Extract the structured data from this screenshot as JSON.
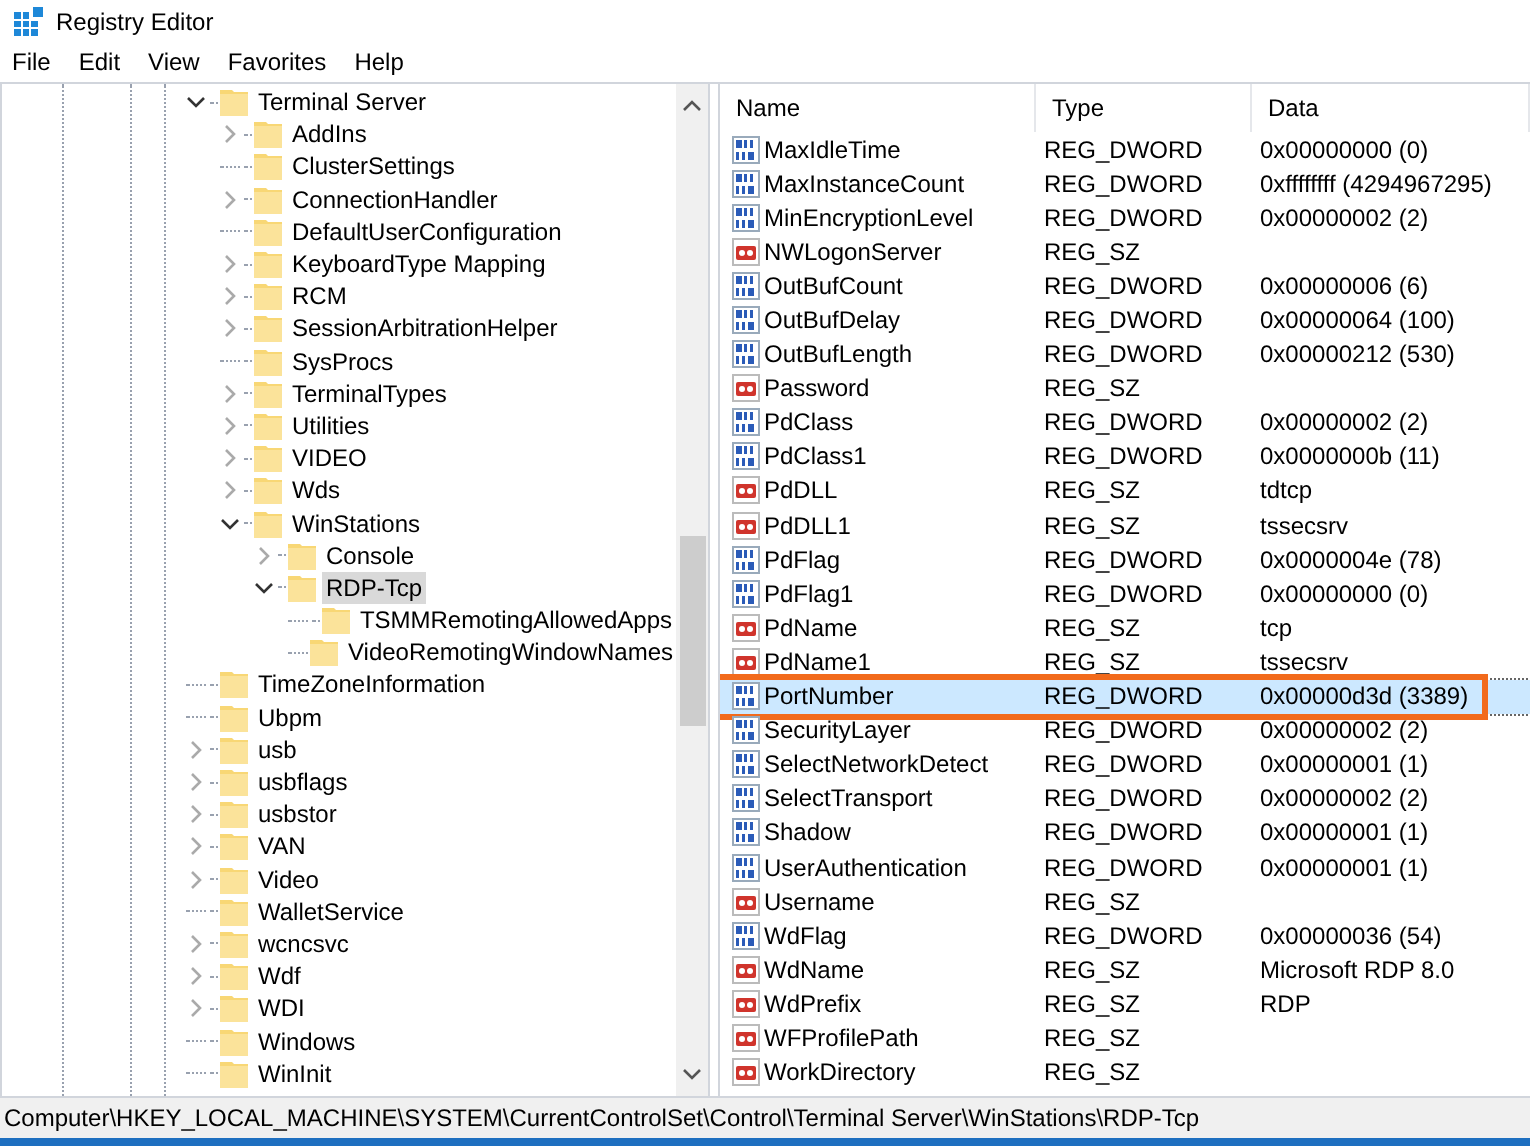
{
  "window": {
    "title": "Registry Editor"
  },
  "menu": [
    "File",
    "Edit",
    "View",
    "Favorites",
    "Help"
  ],
  "tree": [
    {
      "label": "Terminal Server",
      "expanded": true,
      "selected": false,
      "children": [
        {
          "label": "AddIns",
          "expanded": false,
          "selected": false
        },
        {
          "label": "ClusterSettings",
          "selected": false
        },
        {
          "label": "ConnectionHandler",
          "expanded": false,
          "selected": false
        },
        {
          "label": "DefaultUserConfiguration",
          "selected": false
        },
        {
          "label": "KeyboardType Mapping",
          "expanded": false,
          "selected": false
        },
        {
          "label": "RCM",
          "expanded": false,
          "selected": false
        },
        {
          "label": "SessionArbitrationHelper",
          "expanded": false,
          "selected": false
        },
        {
          "label": "SysProcs",
          "selected": false
        },
        {
          "label": "TerminalTypes",
          "expanded": false,
          "selected": false
        },
        {
          "label": "Utilities",
          "expanded": false,
          "selected": false
        },
        {
          "label": "VIDEO",
          "expanded": false,
          "selected": false
        },
        {
          "label": "Wds",
          "expanded": false,
          "selected": false
        },
        {
          "label": "WinStations",
          "expanded": true,
          "selected": false,
          "children": [
            {
              "label": "Console",
              "expanded": false,
              "selected": false
            },
            {
              "label": "RDP-Tcp",
              "expanded": true,
              "selected": true,
              "children": [
                {
                  "label": "TSMMRemotingAllowedApps",
                  "selected": false
                },
                {
                  "label": "VideoRemotingWindowNames",
                  "selected": false
                }
              ]
            }
          ]
        }
      ]
    },
    {
      "label": "TimeZoneInformation",
      "selected": false
    },
    {
      "label": "Ubpm",
      "selected": false
    },
    {
      "label": "usb",
      "expanded": false,
      "selected": false
    },
    {
      "label": "usbflags",
      "expanded": false,
      "selected": false
    },
    {
      "label": "usbstor",
      "expanded": false,
      "selected": false
    },
    {
      "label": "VAN",
      "expanded": false,
      "selected": false
    },
    {
      "label": "Video",
      "expanded": false,
      "selected": false
    },
    {
      "label": "WalletService",
      "selected": false
    },
    {
      "label": "wcncsvc",
      "expanded": false,
      "selected": false
    },
    {
      "label": "Wdf",
      "expanded": false,
      "selected": false
    },
    {
      "label": "WDI",
      "expanded": false,
      "selected": false
    },
    {
      "label": "Windows",
      "selected": false
    },
    {
      "label": "WinInit",
      "selected": false
    }
  ],
  "table": {
    "columns": [
      "Name",
      "Type",
      "Data"
    ],
    "rows": [
      {
        "kind": "dword",
        "name": "MaxIdleTime",
        "type": "REG_DWORD",
        "data": "0x00000000 (0)",
        "selected": false,
        "highlighted": false
      },
      {
        "kind": "dword",
        "name": "MaxInstanceCount",
        "type": "REG_DWORD",
        "data": "0xffffffff (4294967295)",
        "selected": false,
        "highlighted": false
      },
      {
        "kind": "dword",
        "name": "MinEncryptionLevel",
        "type": "REG_DWORD",
        "data": "0x00000002 (2)",
        "selected": false,
        "highlighted": false
      },
      {
        "kind": "string",
        "name": "NWLogonServer",
        "type": "REG_SZ",
        "selected": false,
        "highlighted": false
      },
      {
        "kind": "dword",
        "name": "OutBufCount",
        "type": "REG_DWORD",
        "data": "0x00000006 (6)",
        "selected": false,
        "highlighted": false
      },
      {
        "kind": "dword",
        "name": "OutBufDelay",
        "type": "REG_DWORD",
        "data": "0x00000064 (100)",
        "selected": false,
        "highlighted": false
      },
      {
        "kind": "dword",
        "name": "OutBufLength",
        "type": "REG_DWORD",
        "data": "0x00000212 (530)",
        "selected": false,
        "highlighted": false
      },
      {
        "kind": "string",
        "name": "Password",
        "type": "REG_SZ",
        "selected": false,
        "highlighted": false
      },
      {
        "kind": "dword",
        "name": "PdClass",
        "type": "REG_DWORD",
        "data": "0x00000002 (2)",
        "selected": false,
        "highlighted": false
      },
      {
        "kind": "dword",
        "name": "PdClass1",
        "type": "REG_DWORD",
        "data": "0x0000000b (11)",
        "selected": false,
        "highlighted": false
      },
      {
        "kind": "string",
        "name": "PdDLL",
        "type": "REG_SZ",
        "data": "tdtcp",
        "selected": false,
        "highlighted": false
      },
      {
        "kind": "string",
        "name": "PdDLL1",
        "type": "REG_SZ",
        "data": "tssecsrv",
        "selected": false,
        "highlighted": false
      },
      {
        "kind": "dword",
        "name": "PdFlag",
        "type": "REG_DWORD",
        "data": "0x0000004e (78)",
        "selected": false,
        "highlighted": false
      },
      {
        "kind": "dword",
        "name": "PdFlag1",
        "type": "REG_DWORD",
        "data": "0x00000000 (0)",
        "selected": false,
        "highlighted": false
      },
      {
        "kind": "string",
        "name": "PdName",
        "type": "REG_SZ",
        "data": "tcp",
        "selected": false,
        "highlighted": false
      },
      {
        "kind": "string",
        "name": "PdName1",
        "type": "REG_SZ",
        "data": "tssecsrv",
        "selected": false,
        "highlighted": false
      },
      {
        "kind": "dword",
        "name": "PortNumber",
        "type": "REG_DWORD",
        "data": "0x00000d3d (3389)",
        "selected": true,
        "highlighted": true
      },
      {
        "kind": "dword",
        "name": "SecurityLayer",
        "type": "REG_DWORD",
        "data": "0x00000002 (2)",
        "selected": false,
        "highlighted": false
      },
      {
        "kind": "dword",
        "name": "SelectNetworkDetect",
        "type": "REG_DWORD",
        "data": "0x00000001 (1)",
        "selected": false,
        "highlighted": false
      },
      {
        "kind": "dword",
        "name": "SelectTransport",
        "type": "REG_DWORD",
        "data": "0x00000002 (2)",
        "selected": false,
        "highlighted": false
      },
      {
        "kind": "dword",
        "name": "Shadow",
        "type": "REG_DWORD",
        "data": "0x00000001 (1)",
        "selected": false,
        "highlighted": false
      },
      {
        "kind": "dword",
        "name": "UserAuthentication",
        "type": "REG_DWORD",
        "data": "0x00000001 (1)",
        "selected": false,
        "highlighted": false
      },
      {
        "kind": "string",
        "name": "Username",
        "type": "REG_SZ",
        "selected": false,
        "highlighted": false
      },
      {
        "kind": "dword",
        "name": "WdFlag",
        "type": "REG_DWORD",
        "data": "0x00000036 (54)",
        "selected": false,
        "highlighted": false
      },
      {
        "kind": "string",
        "name": "WdName",
        "type": "REG_SZ",
        "data": "Microsoft RDP 8.0",
        "selected": false,
        "highlighted": false
      },
      {
        "kind": "string",
        "name": "WdPrefix",
        "type": "REG_SZ",
        "data": "RDP",
        "selected": false,
        "highlighted": false
      },
      {
        "kind": "string",
        "name": "WFProfilePath",
        "type": "REG_SZ",
        "selected": false,
        "highlighted": false
      },
      {
        "kind": "string",
        "name": "WorkDirectory",
        "type": "REG_SZ",
        "selected": false,
        "highlighted": false
      }
    ]
  },
  "status_bar": "Computer\\HKEY_LOCAL_MACHINE\\SYSTEM\\CurrentControlSet\\Control\\Terminal Server\\WinStations\\RDP-Tcp"
}
